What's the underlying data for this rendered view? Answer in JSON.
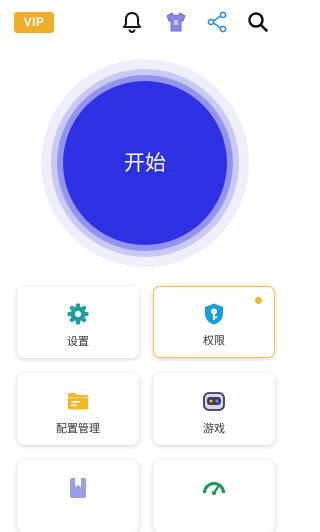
{
  "header": {
    "vip_label": "VIP",
    "icons": [
      "bell-icon",
      "tshirt-icon",
      "share-icon",
      "search-icon"
    ]
  },
  "start": {
    "label": "开始",
    "color": "#2e31e3"
  },
  "tiles": [
    {
      "label": "设置",
      "icon": "gear-icon",
      "color": "#1aa0a0"
    },
    {
      "label": "权限",
      "icon": "shield-key-icon",
      "color": "#1aa0d8",
      "highlighted": true,
      "badge_color": "#f3b62c"
    },
    {
      "label": "配置管理",
      "icon": "folder-icon",
      "color": "#f5b820"
    },
    {
      "label": "游戏",
      "icon": "gamepad-icon",
      "color": "#4a4a66"
    },
    {
      "label": "",
      "icon": "bookmark-book-icon",
      "color": "#7b7fe0"
    },
    {
      "label": "",
      "icon": "speedometer-icon",
      "color": "#1e9a5a"
    }
  ],
  "colors": {
    "vip": "#f0ad2c",
    "accent": "#2e31e3",
    "highlight_border": "#f3c43d"
  }
}
